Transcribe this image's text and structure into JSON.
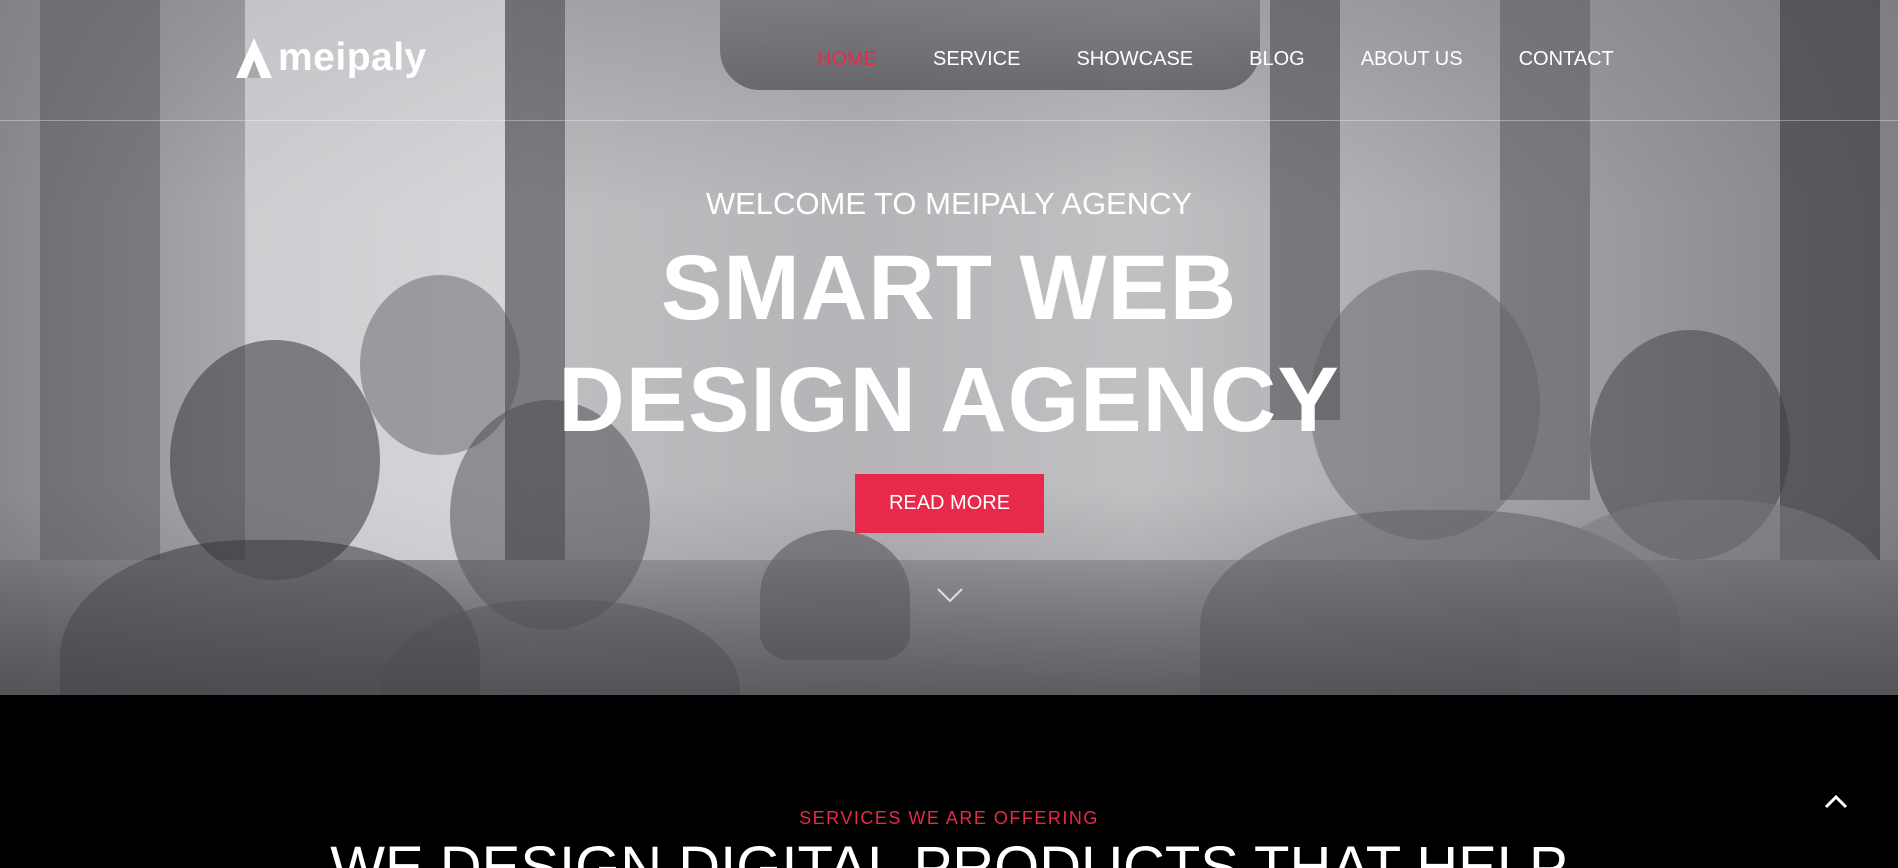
{
  "header": {
    "logo_text": "meipaly",
    "logo_icon": "triangle-logo-icon",
    "nav": [
      {
        "label": "HOME",
        "active": true
      },
      {
        "label": "SERVICE",
        "active": false
      },
      {
        "label": "SHOWCASE",
        "active": false
      },
      {
        "label": "BLOG",
        "active": false
      },
      {
        "label": "ABOUT US",
        "active": false
      },
      {
        "label": "CONTACT",
        "active": false
      }
    ]
  },
  "hero": {
    "welcome": "WELCOME TO MEIPALY AGENCY",
    "headline_line1": "SMART WEB",
    "headline_line2": "DESIGN AGENCY",
    "cta_label": "READ MORE",
    "scroll_icon": "chevron-down-icon"
  },
  "services": {
    "kicker": "SERVICES WE ARE OFFERING",
    "title": "WE DESIGN DIGITAL PRODUCTS THAT HELP"
  },
  "back_to_top_icon": "chevron-up-icon",
  "colors": {
    "accent": "#e8294b",
    "text_light": "#ffffff",
    "section_bg": "#000000"
  }
}
